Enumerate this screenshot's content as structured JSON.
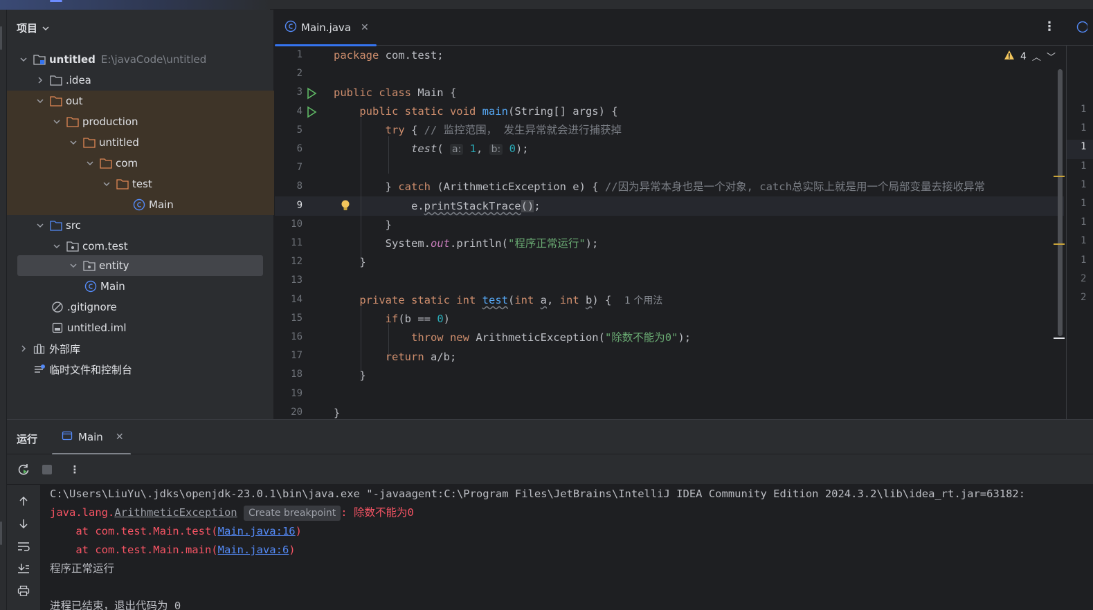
{
  "project_panel": {
    "title": "项目",
    "tree": [
      {
        "label": "untitled",
        "path": "E:\\javaCode\\untitled"
      },
      {
        "label": ".idea"
      },
      {
        "label": "out"
      },
      {
        "label": "production"
      },
      {
        "label": "untitled"
      },
      {
        "label": "com"
      },
      {
        "label": "test"
      },
      {
        "label": "Main"
      },
      {
        "label": "src"
      },
      {
        "label": "com.test"
      },
      {
        "label": "entity"
      },
      {
        "label": "Main"
      },
      {
        "label": ".gitignore"
      },
      {
        "label": "untitled.iml"
      },
      {
        "label": "外部库"
      },
      {
        "label": "临时文件和控制台"
      }
    ]
  },
  "editor": {
    "tab_label": "Main.java",
    "warning_count": "4",
    "line_numbers": [
      "1",
      "2",
      "3",
      "4",
      "5",
      "6",
      "7",
      "8",
      "9",
      "10",
      "11",
      "12",
      "13",
      "14",
      "15",
      "16",
      "17",
      "18",
      "19",
      "20"
    ],
    "current_line": "9",
    "code": {
      "l1_kw": "package",
      "l1_rest": " com.test;",
      "l3_kw": "public class",
      "l3_rest": " Main {",
      "l4_kw": "public static void",
      "l4_fn": "main",
      "l4_rest": "(String[] args) {",
      "l5_kw": "try",
      "l5_rest": " { ",
      "l5_cmt": "// 监控范围， 发生异常就会进行捕获掉",
      "l6_fn": "test",
      "l6_hint_a": "a:",
      "l6_num_a": "1",
      "l6_hint_b": "b:",
      "l6_num_b": "0",
      "l8_kw": "catch",
      "l8_rest": " (ArithmeticException e) { ",
      "l8_cmt": "//因为异常本身也是一个对象, catch总实际上就是用一个局部变量去接收异常",
      "l9_obj": "e.",
      "l9_fn": "printStackTrace",
      "l11_a": "System.",
      "l11_fld": "out",
      "l11_b": ".println(",
      "l11_str": "\"程序正常运行\"",
      "l11_c": ");",
      "l14_kw": "private static int",
      "l14_fn": "test",
      "l14_kw2": "int",
      "l14_a": "a",
      "l14_kw3": "int",
      "l14_b": "b",
      "l14_usage": "1 个用法",
      "l15_kw": "if",
      "l15_rest": "(b == ",
      "l15_num": "0",
      "l16_kw": "throw new",
      "l16_rest": " ArithmeticException(",
      "l16_str": "\"除数不能为0\"",
      "l17_kw": "return",
      "l17_rest": " a/b;"
    },
    "right_peek_numbers": [
      "1",
      "1",
      "1",
      "1",
      "1",
      "1",
      "1",
      "1",
      "1",
      "2",
      "2"
    ]
  },
  "run_panel": {
    "title": "运行",
    "tab_label": "Main",
    "console": {
      "line1": "C:\\Users\\LiuYu\\.jdks\\openjdk-23.0.1\\bin\\java.exe \"-javaagent:C:\\Program Files\\JetBrains\\IntelliJ IDEA Community Edition 2024.3.2\\lib\\idea_rt.jar=63182:",
      "ex_prefix": "java.lang.",
      "ex_class": "ArithmeticException",
      "breakpoint_label": "Create breakpoint",
      "ex_msg": ": 除数不能为0",
      "at1": "    at com.test.Main.test(",
      "link1": "Main.java:16",
      "at2": "    at com.test.Main.main(",
      "link2": "Main.java:6",
      "close": ")",
      "normal": "程序正常运行",
      "exit": "进程已结束，退出代码为 0"
    }
  },
  "colors": {
    "keyword": "#cf8e6d",
    "function": "#56a8f5",
    "string": "#6aab73",
    "number": "#2aacb8",
    "error": "#f75464",
    "link": "#548af7",
    "accent": "#3574f0"
  }
}
